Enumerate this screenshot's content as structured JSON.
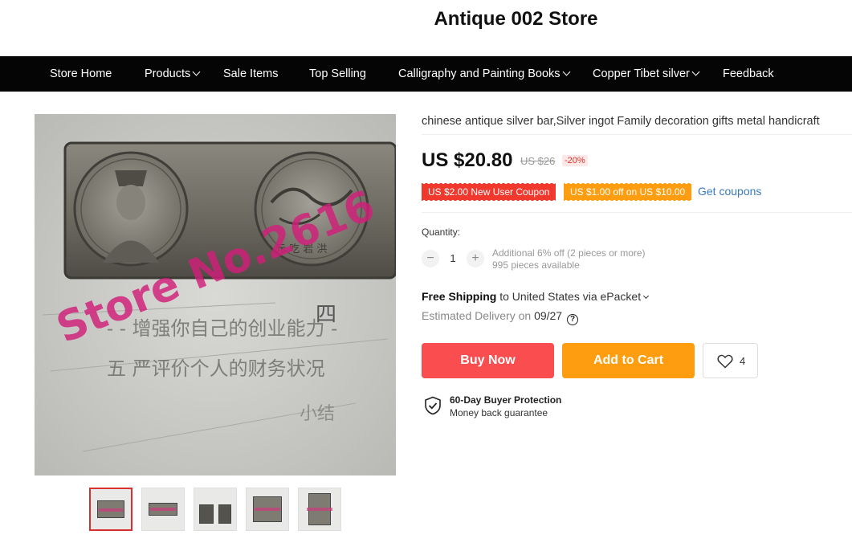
{
  "store": {
    "name": "Antique 002 Store"
  },
  "nav": {
    "items": [
      {
        "label": "Store Home",
        "has_dropdown": false
      },
      {
        "label": "Products",
        "has_dropdown": true
      },
      {
        "label": "Sale Items",
        "has_dropdown": false
      },
      {
        "label": "Top Selling",
        "has_dropdown": false
      },
      {
        "label": "Calligraphy and Painting Books",
        "has_dropdown": true
      },
      {
        "label": "Copper Tibet silver",
        "has_dropdown": true
      },
      {
        "label": "Feedback",
        "has_dropdown": false
      }
    ]
  },
  "gallery": {
    "watermark": "Store No.2616",
    "thumbnail_count": 5,
    "active_thumbnail": 1
  },
  "product": {
    "title": "chinese antique silver bar,Silver ingot Family decoration gifts metal handicraft",
    "price": "US $20.80",
    "original_price": "US $26",
    "discount": "-20%",
    "coupons": [
      {
        "label": "US $2.00 New User Coupon",
        "color": "#f0382d"
      },
      {
        "label": "US $1.00 off on US $10.00",
        "color": "#fd9d0f"
      }
    ],
    "get_coupons_label": "Get coupons"
  },
  "quantity": {
    "label": "Quantity:",
    "value": "1",
    "minus": "−",
    "plus": "+",
    "discount_note": "Additional 6% off (2 pieces or more)",
    "available": "995 pieces available"
  },
  "shipping": {
    "free_label": "Free Shipping",
    "destination": "to United States via ePacket",
    "delivery_prefix": "Estimated Delivery on",
    "delivery_date": "09/27"
  },
  "actions": {
    "buy_now": "Buy Now",
    "add_to_cart": "Add to Cart",
    "wishlist_count": "4"
  },
  "protection": {
    "title": "60-Day Buyer Protection",
    "subtitle": "Money back guarantee"
  },
  "colors": {
    "buy_now": "#f94d4f",
    "add_to_cart": "#fd9d0f",
    "nav_bg": "#050505",
    "link": "#3a7bbf"
  }
}
